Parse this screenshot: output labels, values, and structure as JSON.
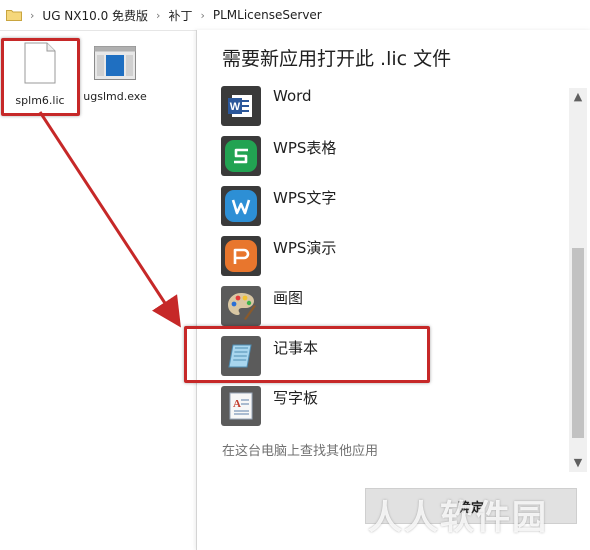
{
  "breadcrumb": {
    "items": [
      "UG NX10.0 免费版",
      "补丁",
      "PLMLicenseServer"
    ],
    "separator": "›"
  },
  "files": [
    {
      "name": "splm6.lic",
      "icon": "blank-file-icon",
      "highlighted": true
    },
    {
      "name": "ugslmd.exe",
      "icon": "exe-window-icon",
      "highlighted": false
    }
  ],
  "dialog": {
    "title": "需要新应用打开此 .lic 文件",
    "apps": [
      {
        "label": "Word",
        "icon": "word-icon",
        "color": "#2b579a"
      },
      {
        "label": "WPS表格",
        "icon": "wps-sheet-icon",
        "color": "#22a352"
      },
      {
        "label": "WPS文字",
        "icon": "wps-writer-icon",
        "color": "#2d8fd5"
      },
      {
        "label": "WPS演示",
        "icon": "wps-presentation-icon",
        "color": "#e8762d"
      },
      {
        "label": "画图",
        "icon": "paint-palette-icon",
        "color": "#5b5b5b"
      },
      {
        "label": "记事本",
        "icon": "notepad-icon",
        "color": "#5b5b5b",
        "highlighted": true
      },
      {
        "label": "写字板",
        "icon": "wordpad-icon",
        "color": "#5b5b5b"
      }
    ],
    "more_link": "在这台电脑上查找其他应用",
    "ok_label": "确定"
  },
  "annotation_color": "#c62828",
  "watermark": "人人软件园"
}
